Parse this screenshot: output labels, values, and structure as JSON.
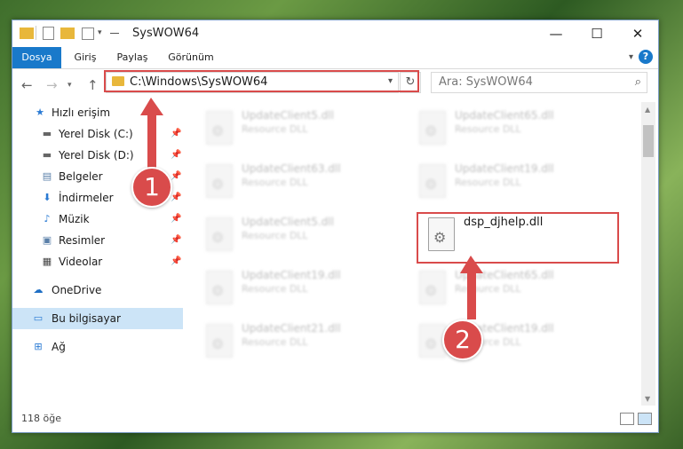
{
  "window": {
    "title": "SysWOW64",
    "controls": {
      "minimize": "—",
      "maximize": "☐",
      "close": "✕"
    }
  },
  "ribbon": {
    "tabs": [
      {
        "label": "Dosya",
        "active": true
      },
      {
        "label": "Giriş",
        "active": false
      },
      {
        "label": "Paylaş",
        "active": false
      },
      {
        "label": "Görünüm",
        "active": false
      }
    ],
    "help": "?"
  },
  "address": {
    "path": "C:\\Windows\\SysWOW64",
    "search_placeholder": "Ara: SysWOW64"
  },
  "sidebar": {
    "items": [
      {
        "label": "Hızlı erişim",
        "icon": "star-icon"
      },
      {
        "label": "Yerel Disk (C:)",
        "icon": "drive-icon",
        "pinned": true
      },
      {
        "label": "Yerel Disk (D:)",
        "icon": "drive-icon",
        "pinned": true
      },
      {
        "label": "Belgeler",
        "icon": "document-icon",
        "pinned": true
      },
      {
        "label": "İndirmeler",
        "icon": "download-icon",
        "pinned": true
      },
      {
        "label": "Müzik",
        "icon": "music-icon",
        "pinned": true
      },
      {
        "label": "Resimler",
        "icon": "pictures-icon",
        "pinned": true
      },
      {
        "label": "Videolar",
        "icon": "video-icon",
        "pinned": true
      },
      {
        "label": "OneDrive",
        "icon": "cloud-icon"
      },
      {
        "label": "Bu bilgisayar",
        "icon": "computer-icon",
        "selected": true
      },
      {
        "label": "Ağ",
        "icon": "network-icon"
      }
    ]
  },
  "files": [
    {
      "name": "UpdateClient5.dll",
      "type": "Resource DLL"
    },
    {
      "name": "UpdateClient65.dll",
      "type": "Resource DLL"
    },
    {
      "name": "UpdateClient63.dll",
      "type": "Resource DLL"
    },
    {
      "name": "UpdateClient19.dll",
      "type": "Resource DLL"
    },
    {
      "name": "UpdateClient5.dll",
      "type": "Resource DLL"
    },
    {
      "name": "dsp_djhelp.dll",
      "type": ""
    },
    {
      "name": "UpdateClient19.dll",
      "type": "Resource DLL"
    },
    {
      "name": "UpdateClient65.dll",
      "type": "Resource DLL"
    },
    {
      "name": "UpdateClient21.dll",
      "type": "Resource DLL"
    },
    {
      "name": "UpdateClient19.dll",
      "type": "Resource DLL"
    }
  ],
  "status": {
    "item_count": "118 öğe"
  },
  "callouts": {
    "first": "1",
    "second": "2"
  },
  "colors": {
    "accent": "#1979ca",
    "highlight": "#d94b4b",
    "selected": "#cce4f7"
  }
}
